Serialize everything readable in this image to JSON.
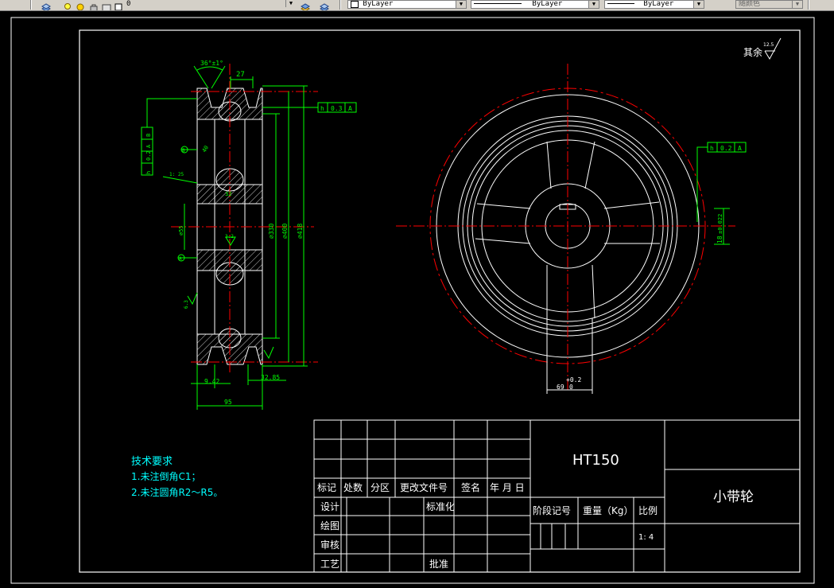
{
  "toolbar": {
    "layer_value": "0",
    "color_dd": "ByLayer",
    "linetype_dd": "ByLayer",
    "lineweight_dd": "ByLayer",
    "plotstyle_dd": "随颜色"
  },
  "drawing": {
    "surface_roughness_label": "其余",
    "surface_roughness_value": "12.5",
    "side_view": {
      "dim_angle": "36°±1°",
      "dim_27": "27",
      "dim_phi330": "⌀330",
      "dim_phi400": "⌀400",
      "dim_phi418": "⌀418",
      "dim_phi55": "⌀55",
      "dim_40": "40",
      "dim_taper": "1: 25",
      "dim_32": "32",
      "dim_3_2": "3.2",
      "dim_6_3": "6.3",
      "dim_9_42": "9.42",
      "dim_32_85": "32.85",
      "dim_95": "95",
      "tol_top": [
        "h",
        "0.3",
        "A"
      ],
      "tol_side": [
        "h",
        "0.2",
        "A",
        "B"
      ],
      "datum_b": "B",
      "datum_a": "A"
    },
    "front_view": {
      "tol_right": [
        "h",
        "0.2",
        "A"
      ],
      "dim_keyway_w": "18",
      "dim_keyway_tol": "±0.022",
      "dim_69": "69",
      "dim_69_tol_up": "+0.2",
      "dim_69_tol_lo": "0"
    },
    "tech_req": {
      "title": "技术要求",
      "line1": "1.未注倒角C1；",
      "line2": "2.未注圆角R2～R5。"
    },
    "title_block": {
      "material": "HT150",
      "part_name": "小带轮",
      "headers": [
        "标记",
        "处数",
        "分区",
        "更改文件号",
        "签名",
        "年 月 日"
      ],
      "rows": [
        "设计",
        "绘图",
        "审核",
        "工艺"
      ],
      "standardize": "标准化",
      "approve": "批准",
      "stage_mark": "阶段记号",
      "weight": "重量（Kg）",
      "scale_label": "比例",
      "scale_value": "1: 4"
    }
  }
}
